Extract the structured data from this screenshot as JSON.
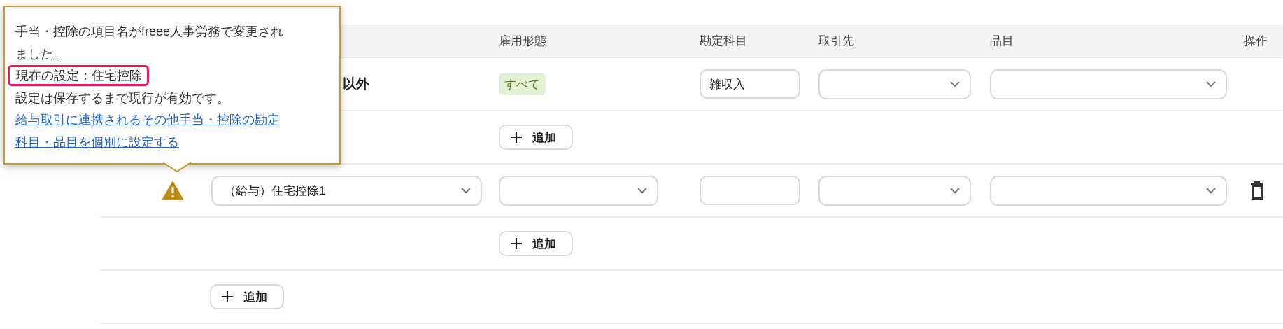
{
  "table": {
    "columns": [
      {
        "label": "雇用形態"
      },
      {
        "label": "勘定科目"
      },
      {
        "label": "取引先"
      },
      {
        "label": "品目"
      },
      {
        "label": "操作"
      }
    ],
    "rows": [
      {
        "kind": "item",
        "name": "以外",
        "employment": "すべて",
        "account": "雑収入"
      },
      {
        "kind": "add",
        "button": "追加"
      },
      {
        "kind": "mapping",
        "warning": true,
        "selection": "（給与）住宅控除1"
      },
      {
        "kind": "add",
        "button": "追加"
      },
      {
        "kind": "add_root",
        "button": "追加"
      }
    ]
  },
  "tooltip": {
    "message": "手当・控除の項目名がfreee人事労務で変更されました。",
    "current": "現在の設定：住宅控除",
    "note": "設定は保存するまで現行が有効です。",
    "link": "給与取引に連携されるその他手当・控除の勘定科目・品目を個別に設定する"
  }
}
